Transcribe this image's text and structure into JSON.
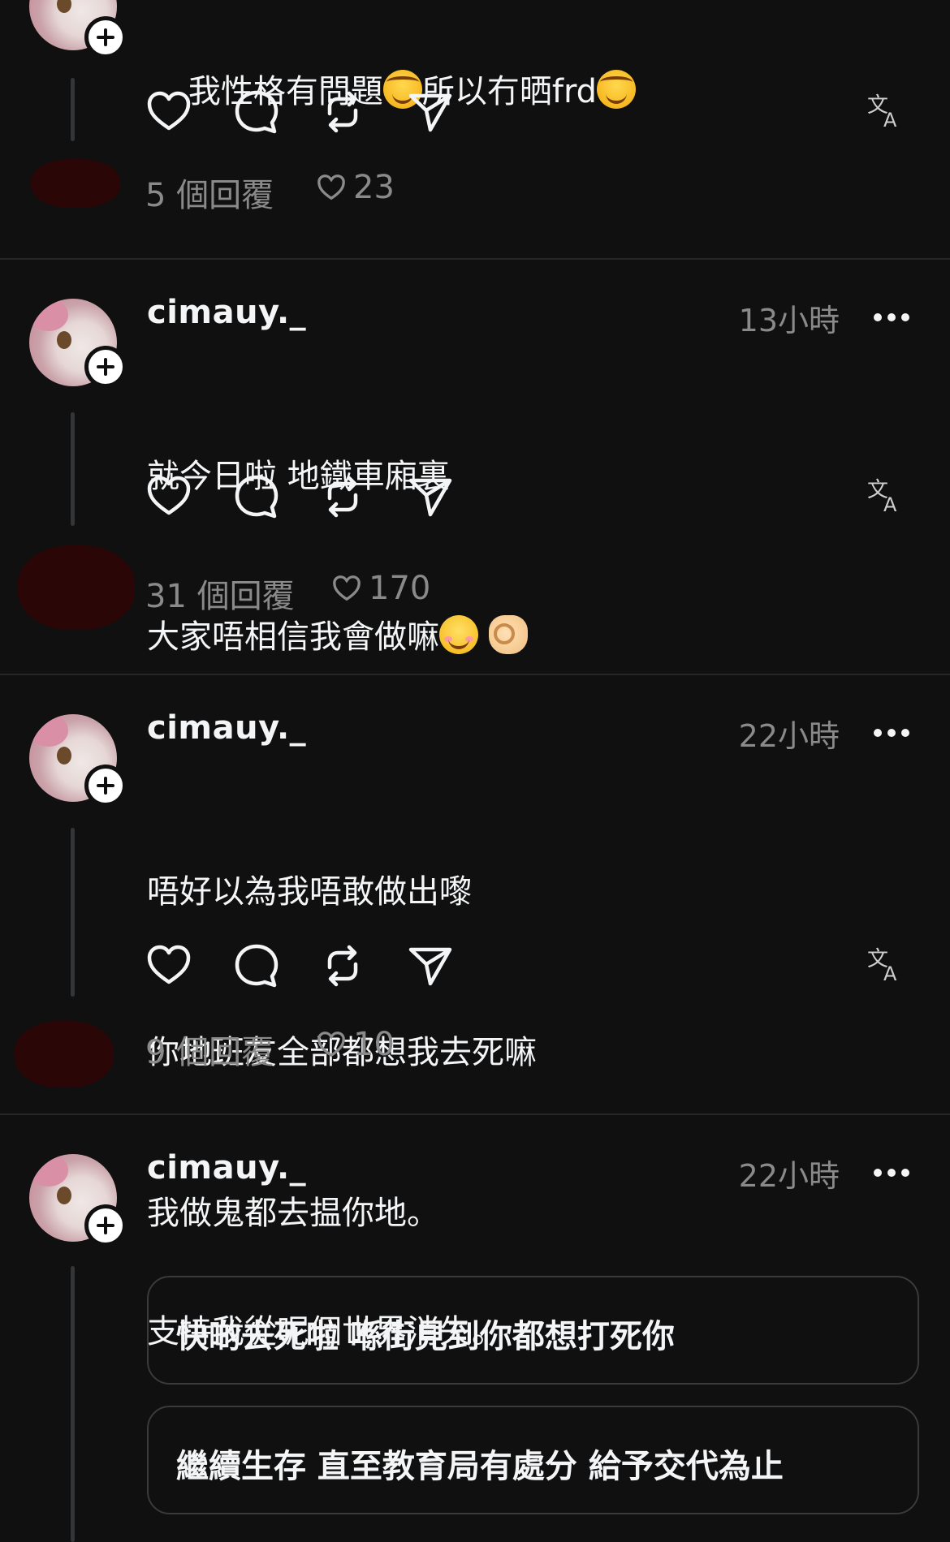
{
  "posts": [
    {
      "text_line1": "我性格有問題",
      "text_line1_b": "所以冇晒frd",
      "emoji_1": "face-with-tears-of-joy",
      "emoji_2": "face-with-tears-of-joy",
      "replies": "5 個回覆",
      "likes": "23"
    },
    {
      "username": "cimauy._",
      "time": "13小時",
      "lines": [
        "就今日啦 地鐵車廂裏",
        "大家唔相信我會做嘛"
      ],
      "emoji_1": "smiling-face-with-smiling-eyes",
      "emoji_2": "ok-hand",
      "replies": "31 個回覆",
      "likes": "170"
    },
    {
      "username": "cimauy._",
      "time": "22小時",
      "lines": [
        "唔好以為我唔敢做出嚟",
        "你地班友全部都想我去死嘛",
        "我做鬼都去揾你地。"
      ],
      "replies": "9 個回覆",
      "likes": "10"
    },
    {
      "username": "cimauy._",
      "time": "22小時",
      "lines": [
        "支持我從呢個世界消失。"
      ],
      "poll_options": [
        "快啲去死啦 喺街見到你都想打死你",
        "繼續生存 直至教育局有處分 給予交代為止"
      ]
    }
  ],
  "icons": {
    "like": "heart-icon",
    "reply": "comment-bubble-icon",
    "repost": "repost-icon",
    "share": "send-icon",
    "translate": "translate-icon",
    "more": "more-dots-icon",
    "follow": "plus-icon"
  },
  "colors": {
    "background": "#101010",
    "text": "#f3f5f7",
    "secondary": "#8a8a8a",
    "divider": "#262626"
  }
}
